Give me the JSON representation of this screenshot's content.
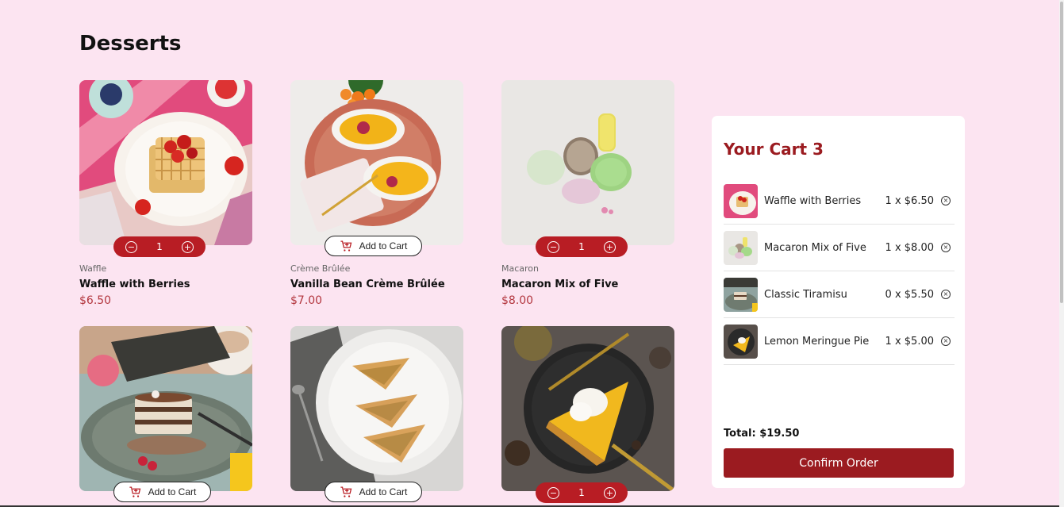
{
  "page": {
    "title": "Desserts"
  },
  "products": [
    {
      "category": "Waffle",
      "name": "Waffle with Berries",
      "price": "$6.50",
      "in_cart": true,
      "quantity": "1"
    },
    {
      "category": "Crème Brûlée",
      "name": "Vanilla Bean Crème Brûlée",
      "price": "$7.00",
      "in_cart": false,
      "button_label": "Add to Cart"
    },
    {
      "category": "Macaron",
      "name": "Macaron Mix of Five",
      "price": "$8.00",
      "in_cart": true,
      "quantity": "1"
    },
    {
      "in_cart": false,
      "button_label": "Add to Cart"
    },
    {
      "in_cart": false,
      "button_label": "Add to Cart"
    },
    {
      "in_cart": true,
      "quantity": "1"
    }
  ],
  "cart": {
    "title": "Your Cart 3",
    "items": [
      {
        "name": "Waffle with Berries",
        "qty_price": "1 x $6.50"
      },
      {
        "name": "Macaron Mix of Five",
        "qty_price": "1 x $8.00"
      },
      {
        "name": "Classic Tiramisu",
        "qty_price": "0 x $5.50"
      },
      {
        "name": "Lemon Meringue Pie",
        "qty_price": "1 x $5.00"
      }
    ],
    "total": "Total: $19.50",
    "confirm_label": "Confirm Order"
  },
  "icons": {
    "decrement": "minus-circle-icon",
    "increment": "plus-circle-icon",
    "add_to_cart": "cart-plus-icon",
    "remove": "remove-circle-icon"
  },
  "colors": {
    "background": "#fce4f1",
    "accent": "#b81d24",
    "cart_title": "#9b1b20",
    "price": "#b3373f"
  }
}
